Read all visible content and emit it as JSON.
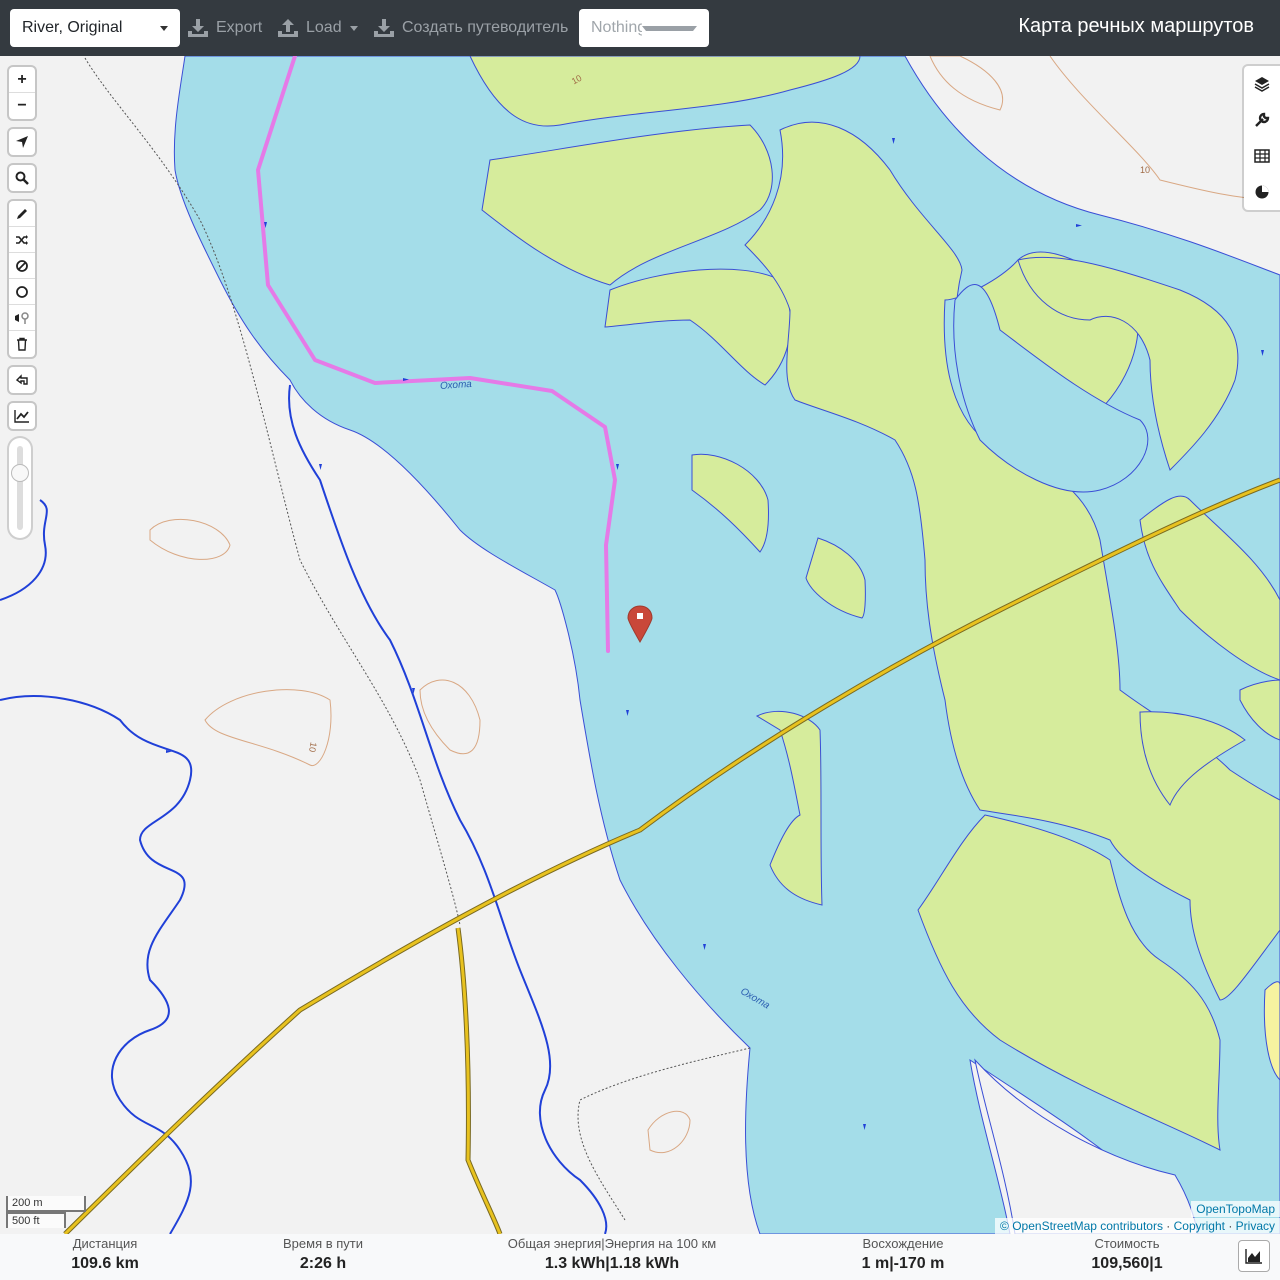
{
  "topbar": {
    "profile": "River, Original",
    "export": "Export",
    "load": "Load",
    "create_guide": "Создать путеводитель",
    "nothing_selected": "Nothing selected",
    "app_title": "Карта речных маршрутов"
  },
  "map": {
    "river_label_1": "Охота",
    "river_label_2": "Охота",
    "contour_label_1": "10",
    "contour_label_2": "10",
    "contour_label_3": "10",
    "scale_metric": "200 m",
    "scale_imperial": "500 ft",
    "attribution_provider": "OpenTopoMap",
    "attribution_osm": "© OpenStreetMap contributors",
    "attribution_copyright": "Copyright",
    "attribution_privacy": "Privacy",
    "colors": {
      "water": "#a4dde9",
      "wetland": "#d6ec9c",
      "route": "#e57ae7",
      "stream": "#2040d8",
      "road": "#e8c21f"
    },
    "controls": [
      "zoom-in-icon",
      "zoom-out-icon",
      "locate-icon",
      "search-icon",
      "draw-icon",
      "shuffle-icon",
      "no-go-icon",
      "circle-icon",
      "poi-icon",
      "delete-icon",
      "undo-icon",
      "chart-icon"
    ],
    "right_controls": [
      "layers-icon",
      "wrench-icon",
      "table-icon",
      "pie-chart-icon"
    ]
  },
  "stats": {
    "distance_label": "Дистанция",
    "distance_value": "109.6 km",
    "time_label": "Время в пути",
    "time_value": "2:26 h",
    "energy_label": "Общая энергия|Энергия на 100 км",
    "energy_value": "1.3 kWh|1.18 kWh",
    "ascent_label": "Восхождение",
    "ascent_value": "1 m|-170 m",
    "cost_label": "Стоимость",
    "cost_value": "109,560|1"
  }
}
